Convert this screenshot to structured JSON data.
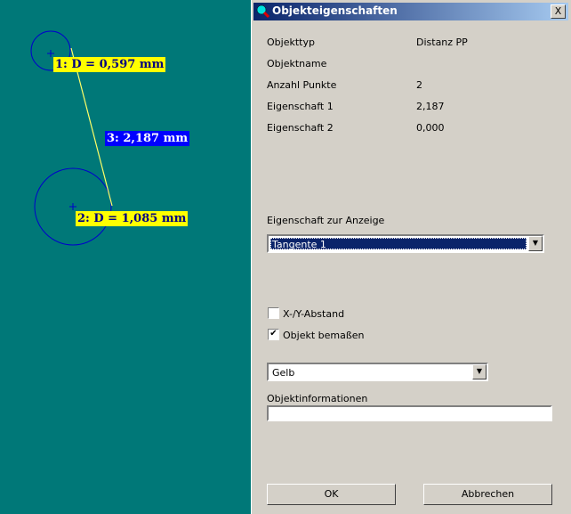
{
  "canvas": {
    "labels": {
      "circle1": "1: D = 0,597  mm",
      "distance": "3: 2,187 mm",
      "circle2": "2: D = 1,085  mm"
    }
  },
  "dialog": {
    "title": "Objekteigenschaften",
    "close": "X",
    "properties": [
      {
        "label": "Objekttyp",
        "value": "Distanz PP"
      },
      {
        "label": "Objektname",
        "value": ""
      },
      {
        "label": "Anzahl Punkte",
        "value": "2"
      },
      {
        "label": "Eigenschaft 1",
        "value": "2,187"
      },
      {
        "label": "Eigenschaft 2",
        "value": "0,000"
      }
    ],
    "display_label": "Eigenschaft zur Anzeige",
    "display_selected": "Tangente 1",
    "xy_label": "X-/Y-Abstand",
    "xy_checked": false,
    "dim_label": "Objekt bemaßen",
    "dim_checked": true,
    "color_selected": "Gelb",
    "info_label": "Objektinformationen",
    "info_value": "",
    "ok": "OK",
    "cancel": "Abbrechen"
  },
  "colors": {
    "canvas": "#007878",
    "label_yellow": "#ffff00",
    "label_blue": "#0000ff",
    "circle": "#0000cc",
    "line": "#ffff66"
  }
}
